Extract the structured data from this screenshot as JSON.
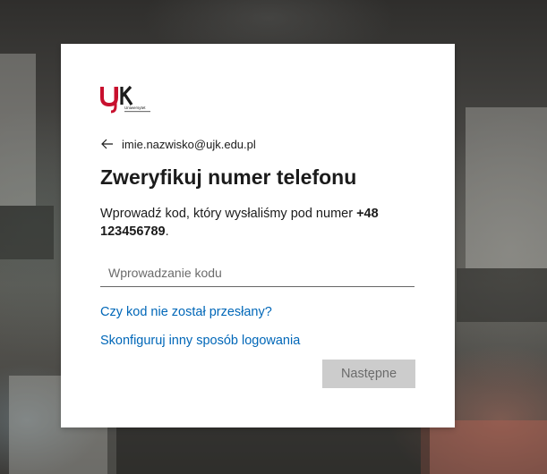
{
  "brand": {
    "logo_letters": "UJK",
    "logo_subtitle": "Uniwersytet",
    "logo_subtitle_small": "Jana Kochanowskiego w Kielcach",
    "accent_color": "#c8102e"
  },
  "identity": {
    "email": "imie.nazwisko@ujk.edu.pl",
    "back_icon": "arrow-left-icon"
  },
  "main": {
    "title": "Zweryfikuj numer telefonu",
    "description_prefix": "Wprowadź kod, który wysłaliśmy pod numer ",
    "phone_number": "+48 123456789",
    "description_suffix": ".",
    "code_input": {
      "value": "",
      "placeholder": "Wprowadzanie kodu"
    },
    "links": {
      "no_code": "Czy kod nie został przesłany?",
      "other_method": "Skonfiguruj inny sposób logowania"
    },
    "next_button": "Następne"
  },
  "colors": {
    "link": "#0067b8",
    "disabled_button_bg": "#cccccc",
    "disabled_button_text": "#6b6b6b"
  }
}
